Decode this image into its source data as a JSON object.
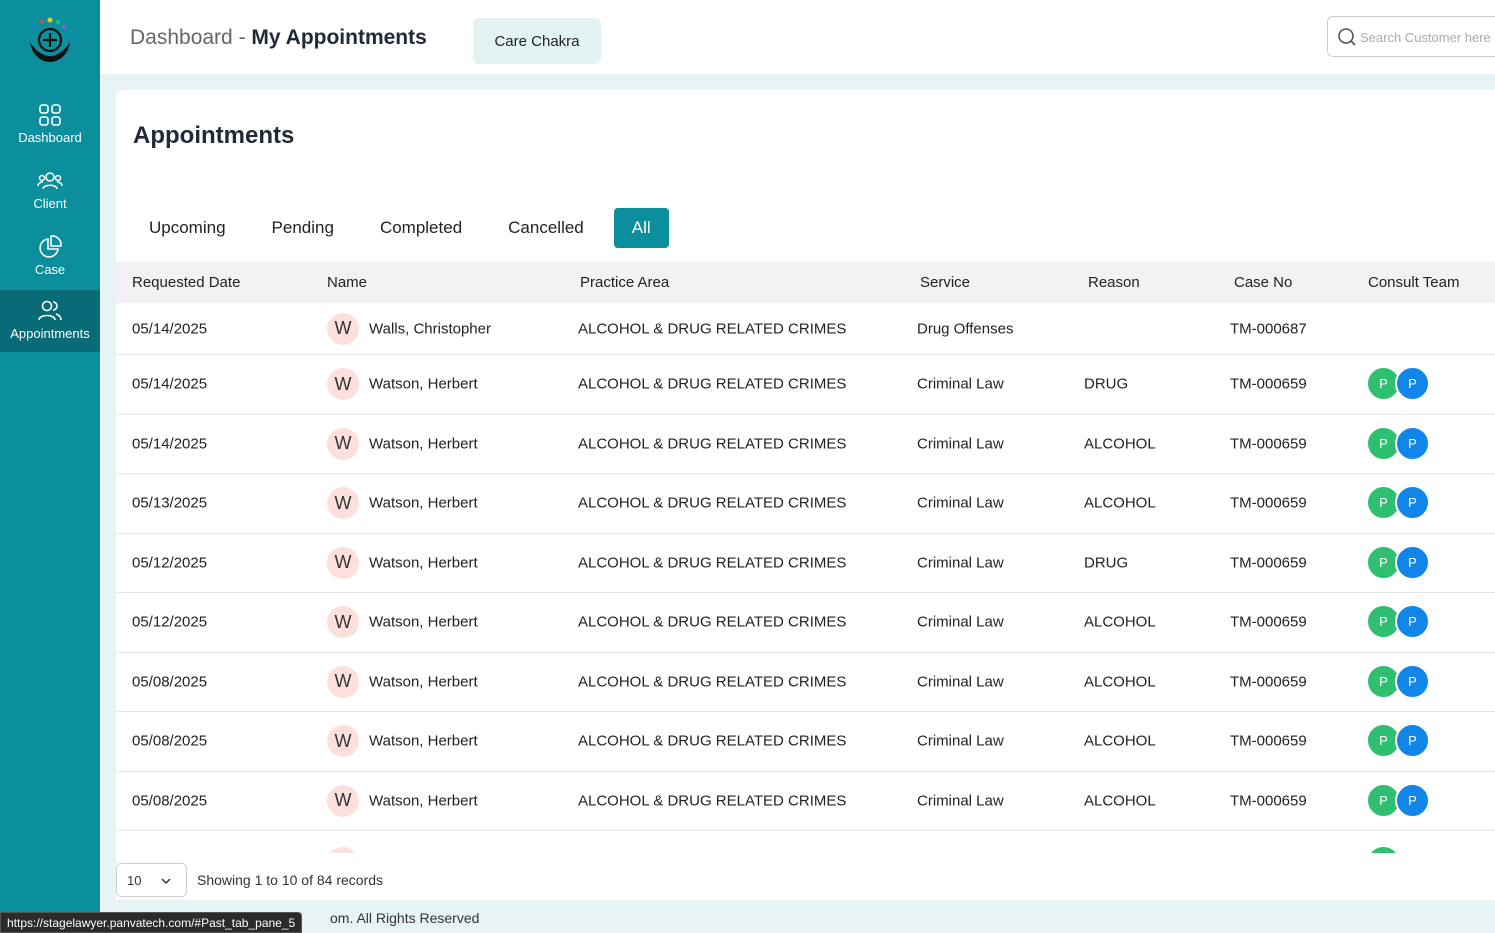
{
  "app": {
    "logo": "care-chakra-logo"
  },
  "sidebar": {
    "items": [
      {
        "label": "Dashboard",
        "icon": "grid-icon"
      },
      {
        "label": "Client",
        "icon": "users-icon"
      },
      {
        "label": "Case",
        "icon": "pie-chart-icon"
      },
      {
        "label": "Appointments",
        "icon": "appointments-icon"
      }
    ],
    "active_index": 3
  },
  "header": {
    "breadcrumb_root": "Dashboard",
    "breadcrumb_separator": "-",
    "breadcrumb_current": "My Appointments",
    "org_chip": "Care Chakra",
    "search_placeholder": "Search Customer here"
  },
  "main": {
    "title": "Appointments",
    "tabs": [
      "Upcoming",
      "Pending",
      "Completed",
      "Cancelled",
      "All"
    ],
    "active_tab": "All",
    "columns": [
      "Requested Date",
      "Name",
      "Practice Area",
      "Service",
      "Reason",
      "Case No",
      "Consult Team"
    ],
    "rows": [
      {
        "date": "05/14/2025",
        "initial": "W",
        "name": "Walls, Christopher",
        "practice": "ALCOHOL & DRUG RELATED CRIMES",
        "service": "Drug Offenses",
        "reason": "",
        "case_no": "TM-000687",
        "team": []
      },
      {
        "date": "05/14/2025",
        "initial": "W",
        "name": "Watson, Herbert",
        "practice": "ALCOHOL & DRUG RELATED CRIMES",
        "service": "Criminal Law",
        "reason": "DRUG",
        "case_no": "TM-000659",
        "team": [
          "P",
          "P"
        ]
      },
      {
        "date": "05/14/2025",
        "initial": "W",
        "name": "Watson, Herbert",
        "practice": "ALCOHOL & DRUG RELATED CRIMES",
        "service": "Criminal Law",
        "reason": "ALCOHOL",
        "case_no": "TM-000659",
        "team": [
          "P",
          "P"
        ]
      },
      {
        "date": "05/13/2025",
        "initial": "W",
        "name": "Watson, Herbert",
        "practice": "ALCOHOL & DRUG RELATED CRIMES",
        "service": "Criminal Law",
        "reason": "ALCOHOL",
        "case_no": "TM-000659",
        "team": [
          "P",
          "P"
        ]
      },
      {
        "date": "05/12/2025",
        "initial": "W",
        "name": "Watson, Herbert",
        "practice": "ALCOHOL & DRUG RELATED CRIMES",
        "service": "Criminal Law",
        "reason": "DRUG",
        "case_no": "TM-000659",
        "team": [
          "P",
          "P"
        ]
      },
      {
        "date": "05/12/2025",
        "initial": "W",
        "name": "Watson, Herbert",
        "practice": "ALCOHOL & DRUG RELATED CRIMES",
        "service": "Criminal Law",
        "reason": "ALCOHOL",
        "case_no": "TM-000659",
        "team": [
          "P",
          "P"
        ]
      },
      {
        "date": "05/08/2025",
        "initial": "W",
        "name": "Watson, Herbert",
        "practice": "ALCOHOL & DRUG RELATED CRIMES",
        "service": "Criminal Law",
        "reason": "ALCOHOL",
        "case_no": "TM-000659",
        "team": [
          "P",
          "P"
        ]
      },
      {
        "date": "05/08/2025",
        "initial": "W",
        "name": "Watson, Herbert",
        "practice": "ALCOHOL & DRUG RELATED CRIMES",
        "service": "Criminal Law",
        "reason": "ALCOHOL",
        "case_no": "TM-000659",
        "team": [
          "P",
          "P"
        ]
      },
      {
        "date": "05/08/2025",
        "initial": "W",
        "name": "Watson, Herbert",
        "practice": "ALCOHOL & DRUG RELATED CRIMES",
        "service": "Criminal Law",
        "reason": "ALCOHOL",
        "case_no": "TM-000659",
        "team": [
          "P",
          "P"
        ]
      }
    ]
  },
  "pagination": {
    "page_size": "10",
    "records_text": "Showing 1 to 10 of 84 records"
  },
  "footer": {
    "text": "om. All Rights Reserved"
  },
  "status_bar": {
    "url": "https://stagelawyer.panvatech.com/#Past_tab_pane_5"
  },
  "colors": {
    "accent": "#0b8f9c",
    "sidebar_active": "#086b76",
    "team_green": "#2fbf71",
    "team_blue": "#1285e8",
    "avatar_bg": "#fde0de"
  }
}
